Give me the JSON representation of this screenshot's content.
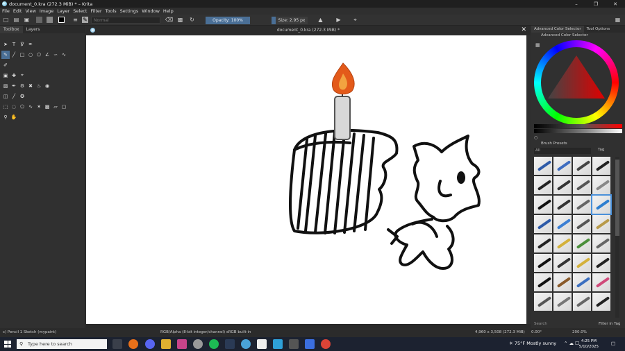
{
  "window": {
    "title": "document_0.kra (272.3 MiB) * – Krita"
  },
  "menu": [
    "File",
    "Edit",
    "View",
    "Image",
    "Layer",
    "Select",
    "Filter",
    "Tools",
    "Settings",
    "Window",
    "Help"
  ],
  "toolbar": {
    "blend_mode": "Normal",
    "opacity": "Opacity: 100%",
    "size": "Size: 2.95 px"
  },
  "left_panel": {
    "tabs": [
      "Toolbox",
      "Layers"
    ]
  },
  "document": {
    "tab_title": "document_0.kra (272.3 MiB) *"
  },
  "right_panel": {
    "tabs": [
      "Advanced Color Selector",
      "Tool Options"
    ],
    "color_selector_title": "Advanced Color Selector",
    "presets_title": "Brush Presets",
    "presets_filter": "All",
    "tag_label": "Tag",
    "search_placeholder": "Search",
    "filter_in_tag": "Filter in Tag"
  },
  "status": {
    "brush": "c) Pencil 1 Sketch (mypaint)",
    "color_space": "RGB/Alpha (8-bit integer/channel)  sRGB built-in",
    "image_size": "4,960 x 3,508 (272.3 MiB)",
    "rotation": "0.00°",
    "zoom": "200.0%"
  },
  "taskbar": {
    "search_placeholder": "Type here to search",
    "weather": "75°F  Mostly sunny",
    "time": "4:25 PM",
    "date": "5/10/2025"
  },
  "colors": {
    "accent": "#4a6f96",
    "selected_preset": "#4a90d9",
    "flame": "#e35a1a"
  }
}
